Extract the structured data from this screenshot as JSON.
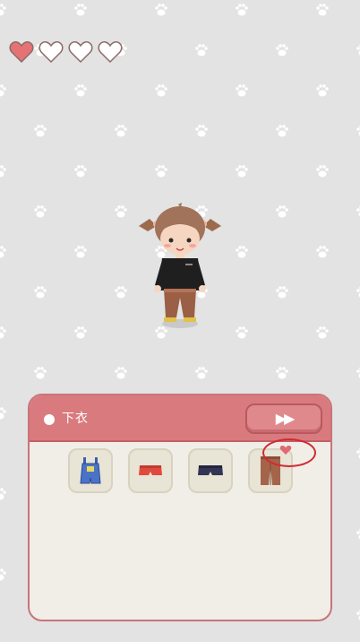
{
  "background": {
    "color": "#e3e3e3",
    "pattern": "paw-icon"
  },
  "lives": {
    "total": 4,
    "filled": 1,
    "filled_color": "#e57373",
    "empty_color": "#ffffff"
  },
  "character": {
    "description_icon": "chibi-girl-pigtails-black-sweater-brown-pants"
  },
  "panel": {
    "title": "下衣",
    "next_button": {
      "label": "▶▶"
    },
    "header_color": "#d97a7e",
    "items": [
      {
        "name": "blue-overalls",
        "icon": "blue-overalls-icon",
        "favorite": false
      },
      {
        "name": "red-shorts",
        "icon": "red-shorts-icon",
        "favorite": false
      },
      {
        "name": "navy-shorts",
        "icon": "navy-shorts-icon",
        "favorite": false
      },
      {
        "name": "brown-pants",
        "icon": "brown-pants-icon",
        "favorite": true
      }
    ]
  }
}
